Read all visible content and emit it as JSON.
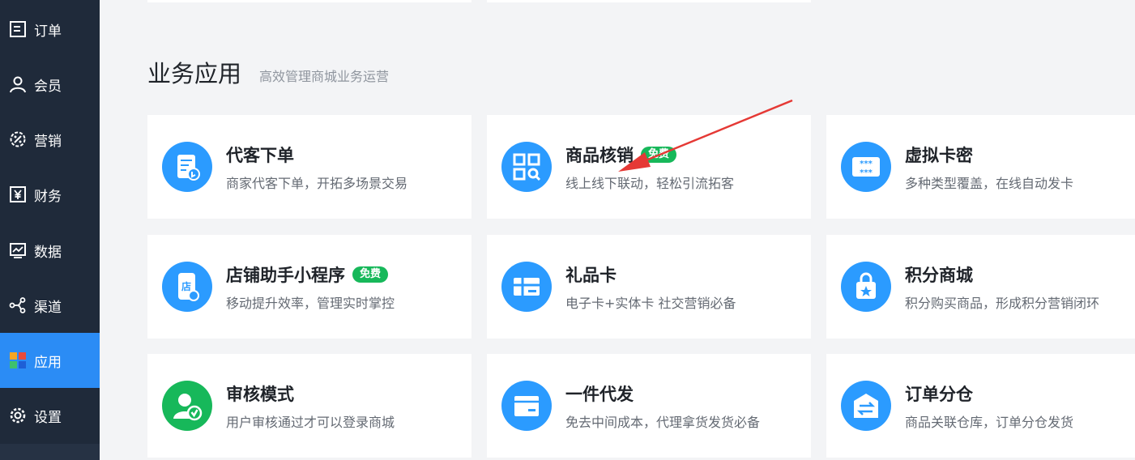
{
  "sidebar": {
    "items": [
      {
        "label": "订单",
        "icon": "order-icon"
      },
      {
        "label": "会员",
        "icon": "user-icon"
      },
      {
        "label": "营销",
        "icon": "marketing-icon"
      },
      {
        "label": "财务",
        "icon": "yen-icon"
      },
      {
        "label": "数据",
        "icon": "chart-icon"
      },
      {
        "label": "渠道",
        "icon": "share-icon"
      },
      {
        "label": "应用",
        "icon": "apps-icon",
        "active": true
      },
      {
        "label": "设置",
        "icon": "gear-icon"
      }
    ]
  },
  "section": {
    "title": "业务应用",
    "subtitle": "高效管理商城业务运营"
  },
  "apps": [
    {
      "title": "代客下单",
      "desc": "商家代客下单，开拓多场景交易",
      "icon": "order-proxy-icon"
    },
    {
      "title": "商品核销",
      "desc": "线上线下联动，轻松引流拓客",
      "icon": "qr-scan-icon",
      "badge": "免费"
    },
    {
      "title": "虚拟卡密",
      "desc": "多种类型覆盖，在线自动发卡",
      "icon": "virtual-card-icon"
    },
    {
      "title": "店铺助手小程序",
      "desc": "移动提升效率，管理实时掌控",
      "icon": "mini-program-icon",
      "badge": "免费"
    },
    {
      "title": "礼品卡",
      "desc": "电子卡+实体卡 社交营销必备",
      "icon": "gift-card-icon"
    },
    {
      "title": "积分商城",
      "desc": "积分购买商品，形成积分营销闭环",
      "icon": "points-bag-icon"
    },
    {
      "title": "审核模式",
      "desc": "用户审核通过才可以登录商城",
      "icon": "user-verify-icon"
    },
    {
      "title": "一件代发",
      "desc": "免去中间成本，代理拿货发货必备",
      "icon": "dropship-box-icon"
    },
    {
      "title": "订单分仓",
      "desc": "商品关联仓库，订单分仓发货",
      "icon": "warehouse-split-icon"
    }
  ],
  "colors": {
    "sidebar_bg": "#1f2a3a",
    "active": "#2b8cf5",
    "icon_blue": "#2b9bff",
    "icon_green": "#17b85a",
    "badge_green": "#17b85a",
    "annotation_arrow": "#e53935"
  }
}
